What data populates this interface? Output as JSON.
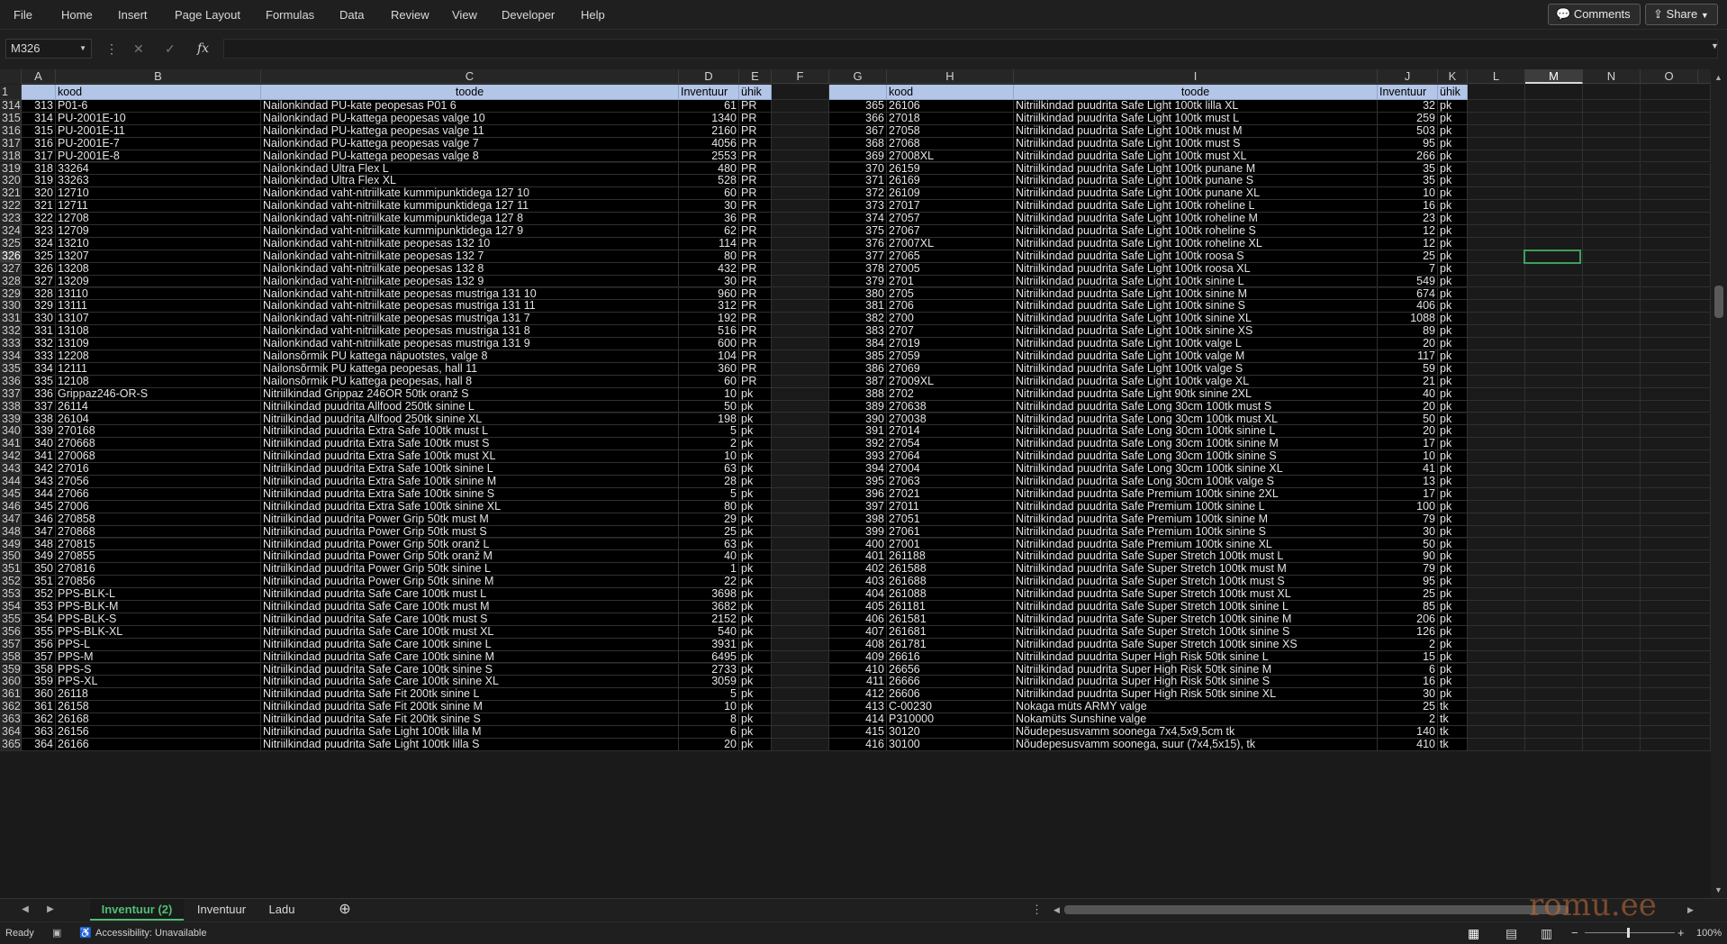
{
  "menu": [
    "File",
    "Home",
    "Insert",
    "Page Layout",
    "Formulas",
    "Data",
    "Review",
    "View",
    "Developer",
    "Help"
  ],
  "buttons": {
    "comments": "Comments",
    "share": "Share"
  },
  "formula_bar": {
    "name_box": "M326",
    "cancel_icon": "✕",
    "enter_icon": "✓",
    "fx_icon": "fx",
    "value": ""
  },
  "columns": [
    "A",
    "B",
    "C",
    "D",
    "E",
    "F",
    "G",
    "H",
    "I",
    "J",
    "K",
    "L",
    "M",
    "N",
    "O"
  ],
  "selected_column": "M",
  "header_row": {
    "row": "1",
    "b": "kood",
    "c": "toode",
    "d": "Inventuur",
    "e": "ühik",
    "h": "kood",
    "i": "toode",
    "j": "Inventuur",
    "k": "ühik"
  },
  "rows": [
    [
      "314",
      "313",
      "P01-6",
      "Nailonkindad PU-kate peopesas P01 6",
      "61",
      "PR",
      "365",
      "26106",
      "Nitriilkindad puudrita Safe Light 100tk lilla XL",
      "32",
      "pk"
    ],
    [
      "315",
      "314",
      "PU-2001E-10",
      "Nailonkindad PU-kattega peopesas valge 10",
      "1340",
      "PR",
      "366",
      "27018",
      "Nitriilkindad puudrita Safe Light 100tk must L",
      "259",
      "pk"
    ],
    [
      "316",
      "315",
      "PU-2001E-11",
      "Nailonkindad PU-kattega peopesas valge 11",
      "2160",
      "PR",
      "367",
      "27058",
      "Nitriilkindad puudrita Safe Light 100tk must M",
      "503",
      "pk"
    ],
    [
      "317",
      "316",
      "PU-2001E-7",
      "Nailonkindad PU-kattega peopesas valge 7",
      "4056",
      "PR",
      "368",
      "27068",
      "Nitriilkindad puudrita Safe Light 100tk must S",
      "95",
      "pk"
    ],
    [
      "318",
      "317",
      "PU-2001E-8",
      "Nailonkindad PU-kattega peopesas valge 8",
      "2553",
      "PR",
      "369",
      "27008XL",
      "Nitriilkindad puudrita Safe Light 100tk must XL",
      "266",
      "pk"
    ],
    [
      "319",
      "318",
      "33264",
      "Nailonkindad Ultra Flex L",
      "480",
      "PR",
      "370",
      "26159",
      "Nitriilkindad puudrita Safe Light 100tk punane M",
      "35",
      "pk"
    ],
    [
      "320",
      "319",
      "33263",
      "Nailonkindad Ultra Flex XL",
      "528",
      "PR",
      "371",
      "26169",
      "Nitriilkindad puudrita Safe Light 100tk punane S",
      "35",
      "pk"
    ],
    [
      "321",
      "320",
      "12710",
      "Nailonkindad vaht-nitriilkate kummipunktidega 127 10",
      "60",
      "PR",
      "372",
      "26109",
      "Nitriilkindad puudrita Safe Light 100tk punane XL",
      "10",
      "pk"
    ],
    [
      "322",
      "321",
      "12711",
      "Nailonkindad vaht-nitriilkate kummipunktidega 127 11",
      "30",
      "PR",
      "373",
      "27017",
      "Nitriilkindad puudrita Safe Light 100tk roheline L",
      "16",
      "pk"
    ],
    [
      "323",
      "322",
      "12708",
      "Nailonkindad vaht-nitriilkate kummipunktidega 127 8",
      "36",
      "PR",
      "374",
      "27057",
      "Nitriilkindad puudrita Safe Light 100tk roheline M",
      "23",
      "pk"
    ],
    [
      "324",
      "323",
      "12709",
      "Nailonkindad vaht-nitriilkate kummipunktidega 127 9",
      "62",
      "PR",
      "375",
      "27067",
      "Nitriilkindad puudrita Safe Light 100tk roheline S",
      "12",
      "pk"
    ],
    [
      "325",
      "324",
      "13210",
      "Nailonkindad vaht-nitriilkate peopesas 132 10",
      "114",
      "PR",
      "376",
      "27007XL",
      "Nitriilkindad puudrita Safe Light 100tk roheline XL",
      "12",
      "pk"
    ],
    [
      "326",
      "325",
      "13207",
      "Nailonkindad vaht-nitriilkate peopesas 132 7",
      "80",
      "PR",
      "377",
      "27065",
      "Nitriilkindad puudrita Safe Light 100tk roosa S",
      "25",
      "pk"
    ],
    [
      "327",
      "326",
      "13208",
      "Nailonkindad vaht-nitriilkate peopesas 132 8",
      "432",
      "PR",
      "378",
      "27005",
      "Nitriilkindad puudrita Safe Light 100tk roosa XL",
      "7",
      "pk"
    ],
    [
      "328",
      "327",
      "13209",
      "Nailonkindad vaht-nitriilkate peopesas 132 9",
      "30",
      "PR",
      "379",
      "2701",
      "Nitriilkindad puudrita Safe Light 100tk sinine L",
      "549",
      "pk"
    ],
    [
      "329",
      "328",
      "13110",
      "Nailonkindad vaht-nitriilkate peopesas mustriga 131 10",
      "960",
      "PR",
      "380",
      "2705",
      "Nitriilkindad puudrita Safe Light 100tk sinine M",
      "674",
      "pk"
    ],
    [
      "330",
      "329",
      "13111",
      "Nailonkindad vaht-nitriilkate peopesas mustriga 131 11",
      "312",
      "PR",
      "381",
      "2706",
      "Nitriilkindad puudrita Safe Light 100tk sinine S",
      "406",
      "pk"
    ],
    [
      "331",
      "330",
      "13107",
      "Nailonkindad vaht-nitriilkate peopesas mustriga 131 7",
      "192",
      "PR",
      "382",
      "2700",
      "Nitriilkindad puudrita Safe Light 100tk sinine XL",
      "1088",
      "pk"
    ],
    [
      "332",
      "331",
      "13108",
      "Nailonkindad vaht-nitriilkate peopesas mustriga 131 8",
      "516",
      "PR",
      "383",
      "2707",
      "Nitriilkindad puudrita Safe Light 100tk sinine XS",
      "89",
      "pk"
    ],
    [
      "333",
      "332",
      "13109",
      "Nailonkindad vaht-nitriilkate peopesas mustriga 131 9",
      "600",
      "PR",
      "384",
      "27019",
      "Nitriilkindad puudrita Safe Light 100tk valge L",
      "20",
      "pk"
    ],
    [
      "334",
      "333",
      "12208",
      "Nailonsõrmik PU kattega näpuotstes, valge 8",
      "104",
      "PR",
      "385",
      "27059",
      "Nitriilkindad puudrita Safe Light 100tk valge M",
      "117",
      "pk"
    ],
    [
      "335",
      "334",
      "12111",
      "Nailonsõrmik PU kattega peopesas, hall 11",
      "360",
      "PR",
      "386",
      "27069",
      "Nitriilkindad puudrita Safe Light 100tk valge S",
      "59",
      "pk"
    ],
    [
      "336",
      "335",
      "12108",
      "Nailonsõrmik PU kattega peopesas, hall 8",
      "60",
      "PR",
      "387",
      "27009XL",
      "Nitriilkindad puudrita Safe Light 100tk valge XL",
      "21",
      "pk"
    ],
    [
      "337",
      "336",
      "Grippaz246-OR-S",
      "Nitriilkindad Grippaz 246OR 50tk oranž S",
      "10",
      "pk",
      "388",
      "2702",
      "Nitriilkindad puudrita Safe Light 90tk sinine 2XL",
      "40",
      "pk"
    ],
    [
      "338",
      "337",
      "26114",
      "Nitriilkindad puudrita Allfood 250tk sinine L",
      "50",
      "pk",
      "389",
      "270638",
      "Nitriilkindad puudrita Safe Long 30cm 100tk must S",
      "20",
      "pk"
    ],
    [
      "339",
      "338",
      "26104",
      "Nitriilkindad puudrita Allfood 250tk sinine XL",
      "198",
      "pk",
      "390",
      "270038",
      "Nitriilkindad puudrita Safe Long 30cm 100tk must XL",
      "50",
      "pk"
    ],
    [
      "340",
      "339",
      "270168",
      "Nitriilkindad puudrita Extra Safe 100tk must L",
      "5",
      "pk",
      "391",
      "27014",
      "Nitriilkindad puudrita Safe Long 30cm 100tk sinine L",
      "20",
      "pk"
    ],
    [
      "341",
      "340",
      "270668",
      "Nitriilkindad puudrita Extra Safe 100tk must S",
      "2",
      "pk",
      "392",
      "27054",
      "Nitriilkindad puudrita Safe Long 30cm 100tk sinine M",
      "17",
      "pk"
    ],
    [
      "342",
      "341",
      "270068",
      "Nitriilkindad puudrita Extra Safe 100tk must XL",
      "10",
      "pk",
      "393",
      "27064",
      "Nitriilkindad puudrita Safe Long 30cm 100tk sinine S",
      "10",
      "pk"
    ],
    [
      "343",
      "342",
      "27016",
      "Nitriilkindad puudrita Extra Safe 100tk sinine L",
      "63",
      "pk",
      "394",
      "27004",
      "Nitriilkindad puudrita Safe Long 30cm 100tk sinine XL",
      "41",
      "pk"
    ],
    [
      "344",
      "343",
      "27056",
      "Nitriilkindad puudrita Extra Safe 100tk sinine M",
      "28",
      "pk",
      "395",
      "27063",
      "Nitriilkindad puudrita Safe Long 30cm 100tk valge S",
      "13",
      "pk"
    ],
    [
      "345",
      "344",
      "27066",
      "Nitriilkindad puudrita Extra Safe 100tk sinine S",
      "5",
      "pk",
      "396",
      "27021",
      "Nitriilkindad puudrita Safe Premium 100tk sinine 2XL",
      "17",
      "pk"
    ],
    [
      "346",
      "345",
      "27006",
      "Nitriilkindad puudrita Extra Safe 100tk sinine XL",
      "80",
      "pk",
      "397",
      "27011",
      "Nitriilkindad puudrita Safe Premium 100tk sinine L",
      "100",
      "pk"
    ],
    [
      "347",
      "346",
      "270858",
      "Nitriilkindad puudrita Power Grip 50tk must M",
      "29",
      "pk",
      "398",
      "27051",
      "Nitriilkindad puudrita Safe Premium 100tk sinine M",
      "79",
      "pk"
    ],
    [
      "348",
      "347",
      "270868",
      "Nitriilkindad puudrita Power Grip 50tk must S",
      "25",
      "pk",
      "399",
      "27061",
      "Nitriilkindad puudrita Safe Premium 100tk sinine S",
      "30",
      "pk"
    ],
    [
      "349",
      "348",
      "270815",
      "Nitriilkindad puudrita Power Grip 50tk oranž L",
      "63",
      "pk",
      "400",
      "27001",
      "Nitriilkindad puudrita Safe Premium 100tk sinine XL",
      "50",
      "pk"
    ],
    [
      "350",
      "349",
      "270855",
      "Nitriilkindad puudrita Power Grip 50tk oranž M",
      "40",
      "pk",
      "401",
      "261188",
      "Nitriilkindad puudrita Safe Super Stretch 100tk must L",
      "90",
      "pk"
    ],
    [
      "351",
      "350",
      "270816",
      "Nitriilkindad puudrita Power Grip 50tk sinine L",
      "1",
      "pk",
      "402",
      "261588",
      "Nitriilkindad puudrita Safe Super Stretch 100tk must M",
      "79",
      "pk"
    ],
    [
      "352",
      "351",
      "270856",
      "Nitriilkindad puudrita Power Grip 50tk sinine M",
      "22",
      "pk",
      "403",
      "261688",
      "Nitriilkindad puudrita Safe Super Stretch 100tk must S",
      "95",
      "pk"
    ],
    [
      "353",
      "352",
      "PPS-BLK-L",
      "Nitriilkindad puudrita Safe Care 100tk must L",
      "3698",
      "pk",
      "404",
      "261088",
      "Nitriilkindad puudrita Safe Super Stretch 100tk must XL",
      "25",
      "pk"
    ],
    [
      "354",
      "353",
      "PPS-BLK-M",
      "Nitriilkindad puudrita Safe Care 100tk must M",
      "3682",
      "pk",
      "405",
      "261181",
      "Nitriilkindad puudrita Safe Super Stretch 100tk sinine L",
      "85",
      "pk"
    ],
    [
      "355",
      "354",
      "PPS-BLK-S",
      "Nitriilkindad puudrita Safe Care 100tk must S",
      "2152",
      "pk",
      "406",
      "261581",
      "Nitriilkindad puudrita Safe Super Stretch 100tk sinine M",
      "206",
      "pk"
    ],
    [
      "356",
      "355",
      "PPS-BLK-XL",
      "Nitriilkindad puudrita Safe Care 100tk must XL",
      "540",
      "pk",
      "407",
      "261681",
      "Nitriilkindad puudrita Safe Super Stretch 100tk sinine S",
      "126",
      "pk"
    ],
    [
      "357",
      "356",
      "PPS-L",
      "Nitriilkindad puudrita Safe Care 100tk sinine L",
      "3931",
      "pk",
      "408",
      "261781",
      "Nitriilkindad puudrita Safe Super Stretch 100tk sinine XS",
      "2",
      "pk"
    ],
    [
      "358",
      "357",
      "PPS-M",
      "Nitriilkindad puudrita Safe Care 100tk sinine M",
      "6495",
      "pk",
      "409",
      "26616",
      "Nitriilkindad puudrita Super High Risk 50tk sinine L",
      "15",
      "pk"
    ],
    [
      "359",
      "358",
      "PPS-S",
      "Nitriilkindad puudrita Safe Care 100tk sinine S",
      "2733",
      "pk",
      "410",
      "26656",
      "Nitriilkindad puudrita Super High Risk 50tk sinine M",
      "6",
      "pk"
    ],
    [
      "360",
      "359",
      "PPS-XL",
      "Nitriilkindad puudrita Safe Care 100tk sinine XL",
      "3059",
      "pk",
      "411",
      "26666",
      "Nitriilkindad puudrita Super High Risk 50tk sinine S",
      "16",
      "pk"
    ],
    [
      "361",
      "360",
      "26118",
      "Nitriilkindad puudrita Safe Fit 200tk sinine L",
      "5",
      "pk",
      "412",
      "26606",
      "Nitriilkindad puudrita Super High Risk 50tk sinine XL",
      "30",
      "pk"
    ],
    [
      "362",
      "361",
      "26158",
      "Nitriilkindad puudrita Safe Fit 200tk sinine M",
      "10",
      "pk",
      "413",
      "C-00230",
      "Nokaga müts ARMY valge",
      "25",
      "tk"
    ],
    [
      "363",
      "362",
      "26168",
      "Nitriilkindad puudrita Safe Fit 200tk sinine S",
      "8",
      "pk",
      "414",
      "P310000",
      "Nokamüts Sunshine valge",
      "2",
      "tk"
    ],
    [
      "364",
      "363",
      "26156",
      "Nitriilkindad puudrita Safe Light 100tk lilla M",
      "6",
      "pk",
      "415",
      "30120",
      "Nõudepesusvamm soonega 7x4,5x9,5cm tk",
      "140",
      "tk"
    ],
    [
      "365",
      "364",
      "26166",
      "Nitriilkindad puudrita Safe Light 100tk lilla S",
      "20",
      "pk",
      "416",
      "30100",
      "Nõudepesusvamm soonega, suur (7x4,5x15), tk",
      "410",
      "tk"
    ]
  ],
  "sheet_tabs": [
    "Inventuur (2)",
    "Inventuur",
    "Ladu"
  ],
  "active_tab": "Inventuur (2)",
  "status": {
    "ready": "Ready",
    "accessibility": "Accessibility: Unavailable",
    "zoom": "100%"
  },
  "watermark": "romu.ee"
}
